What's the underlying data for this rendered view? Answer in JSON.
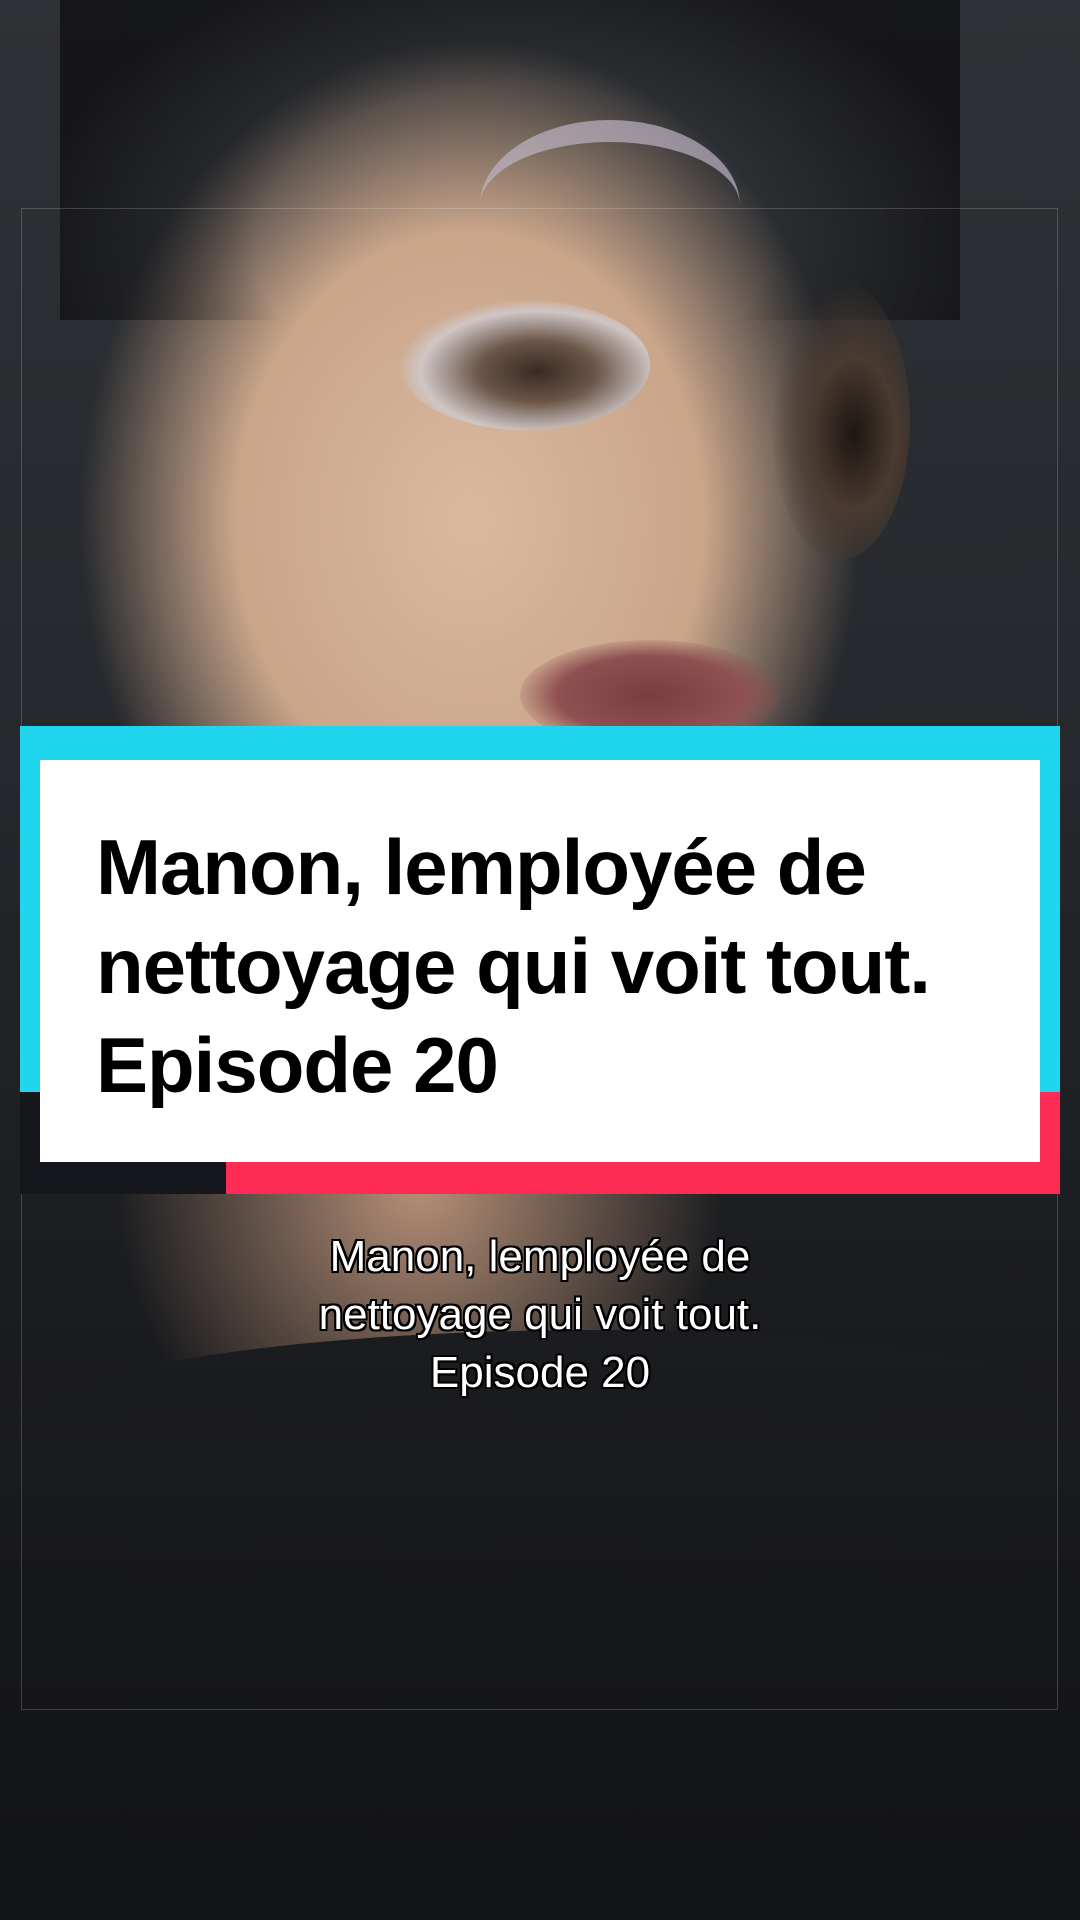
{
  "video": {
    "description_icon": "video-frame"
  },
  "title_card": {
    "lines": [
      "Manon, lemployée de",
      "nettoyage qui voit tout.",
      "Episode 20"
    ],
    "colors": {
      "accent_cyan": "#20d5ee",
      "accent_red": "#fe2c55",
      "accent_dark": "#15171c",
      "panel": "#ffffff",
      "text": "#000000"
    }
  },
  "caption": {
    "lines": [
      "Manon, lemployée de",
      "nettoyage qui voit tout.",
      "Episode 20"
    ],
    "color": "#ffffff"
  }
}
